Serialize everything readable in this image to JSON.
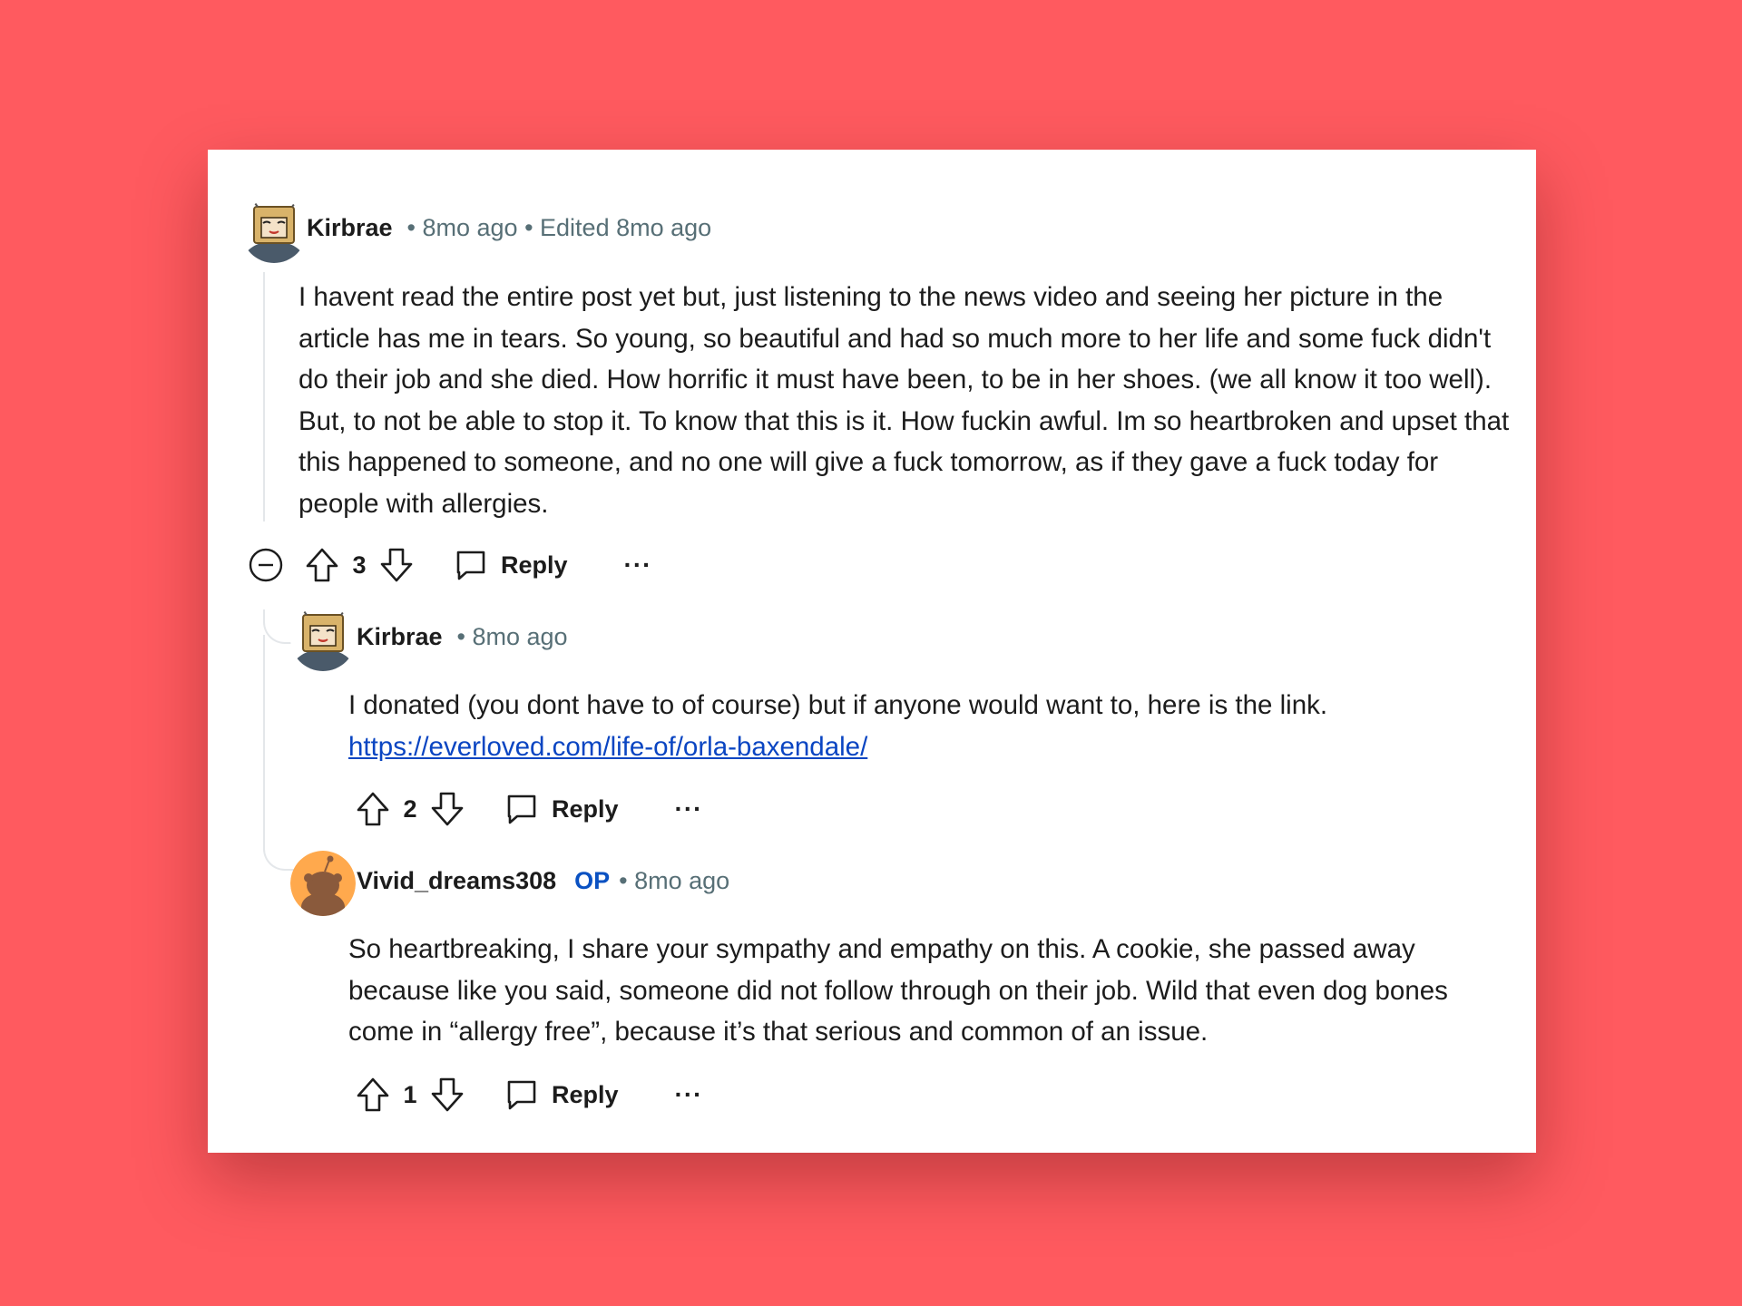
{
  "comments": [
    {
      "author": "Kirbrae",
      "meta": "• 8mo ago • Edited 8mo ago",
      "body": "I havent read the entire post yet but, just listening to the news video and seeing her picture in the article has me in tears. So young, so beautiful and had so much more to her life and some fuck didn't do their job and she died. How horrific it must have been, to be in her shoes. (we all know it too well). But, to not be able to stop it. To know that this is it. How fuckin awful. Im so heartbroken and upset that this happened to someone, and no one will give a fuck tomorrow, as if they gave a fuck today for people with allergies.",
      "score": "3",
      "reply_label": "Reply",
      "more_label": "···"
    },
    {
      "author": "Kirbrae",
      "meta": "• 8mo ago",
      "body": "I donated (you dont have to of course) but if anyone would want to, here is the link.",
      "link": "https://everloved.com/life-of/orla-baxendale/",
      "score": "2",
      "reply_label": "Reply",
      "more_label": "···"
    },
    {
      "author": "Vivid_dreams308",
      "op_badge": "OP",
      "meta": "• 8mo ago",
      "body": "So heartbreaking, I share your sympathy and empathy on this. A cookie, she passed away because like you said, someone did not follow through on their job. Wild that even dog bones come in “allergy free”, because it’s that serious and common of an issue.",
      "score": "1",
      "reply_label": "Reply",
      "more_label": "···"
    }
  ],
  "icons": {
    "collapse": "collapse-icon",
    "upvote": "upvote-icon",
    "downvote": "downvote-icon",
    "reply": "comment-bubble-icon"
  },
  "colors": {
    "background": "#ff5a5f",
    "op_badge": "#0a51c2",
    "link": "#0a45c2",
    "meta_text": "#576f76"
  }
}
